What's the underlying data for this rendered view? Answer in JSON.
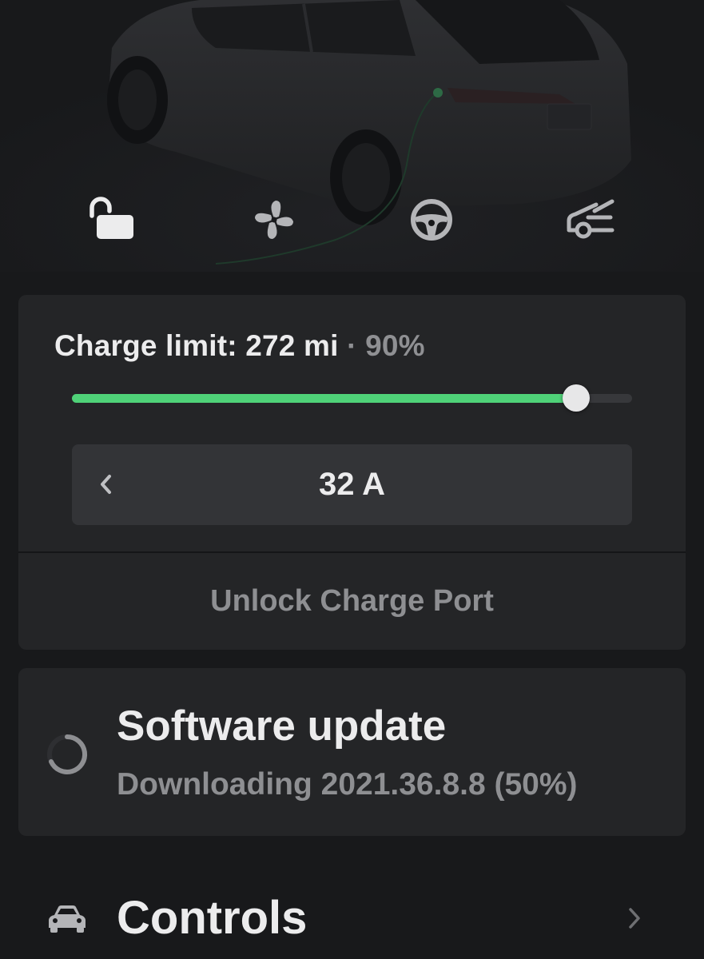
{
  "quick_actions": [
    {
      "icon": "unlock-icon",
      "active": true
    },
    {
      "icon": "fan-icon",
      "active": false
    },
    {
      "icon": "steering-wheel-icon",
      "active": false
    },
    {
      "icon": "frunk-icon",
      "active": false
    }
  ],
  "charging": {
    "limit_label": "Charge limit: 272 mi",
    "separator": "·",
    "limit_percent_label": "90%",
    "limit_percent_value": 90,
    "amperage": "32 A",
    "unlock_port_label": "Unlock Charge Port",
    "accent_color": "#4fd278"
  },
  "software_update": {
    "title": "Software update",
    "status": "Downloading 2021.36.8.8 (50%)",
    "progress_percent": 50
  },
  "controls": {
    "icon": "car-icon",
    "label": "Controls"
  }
}
